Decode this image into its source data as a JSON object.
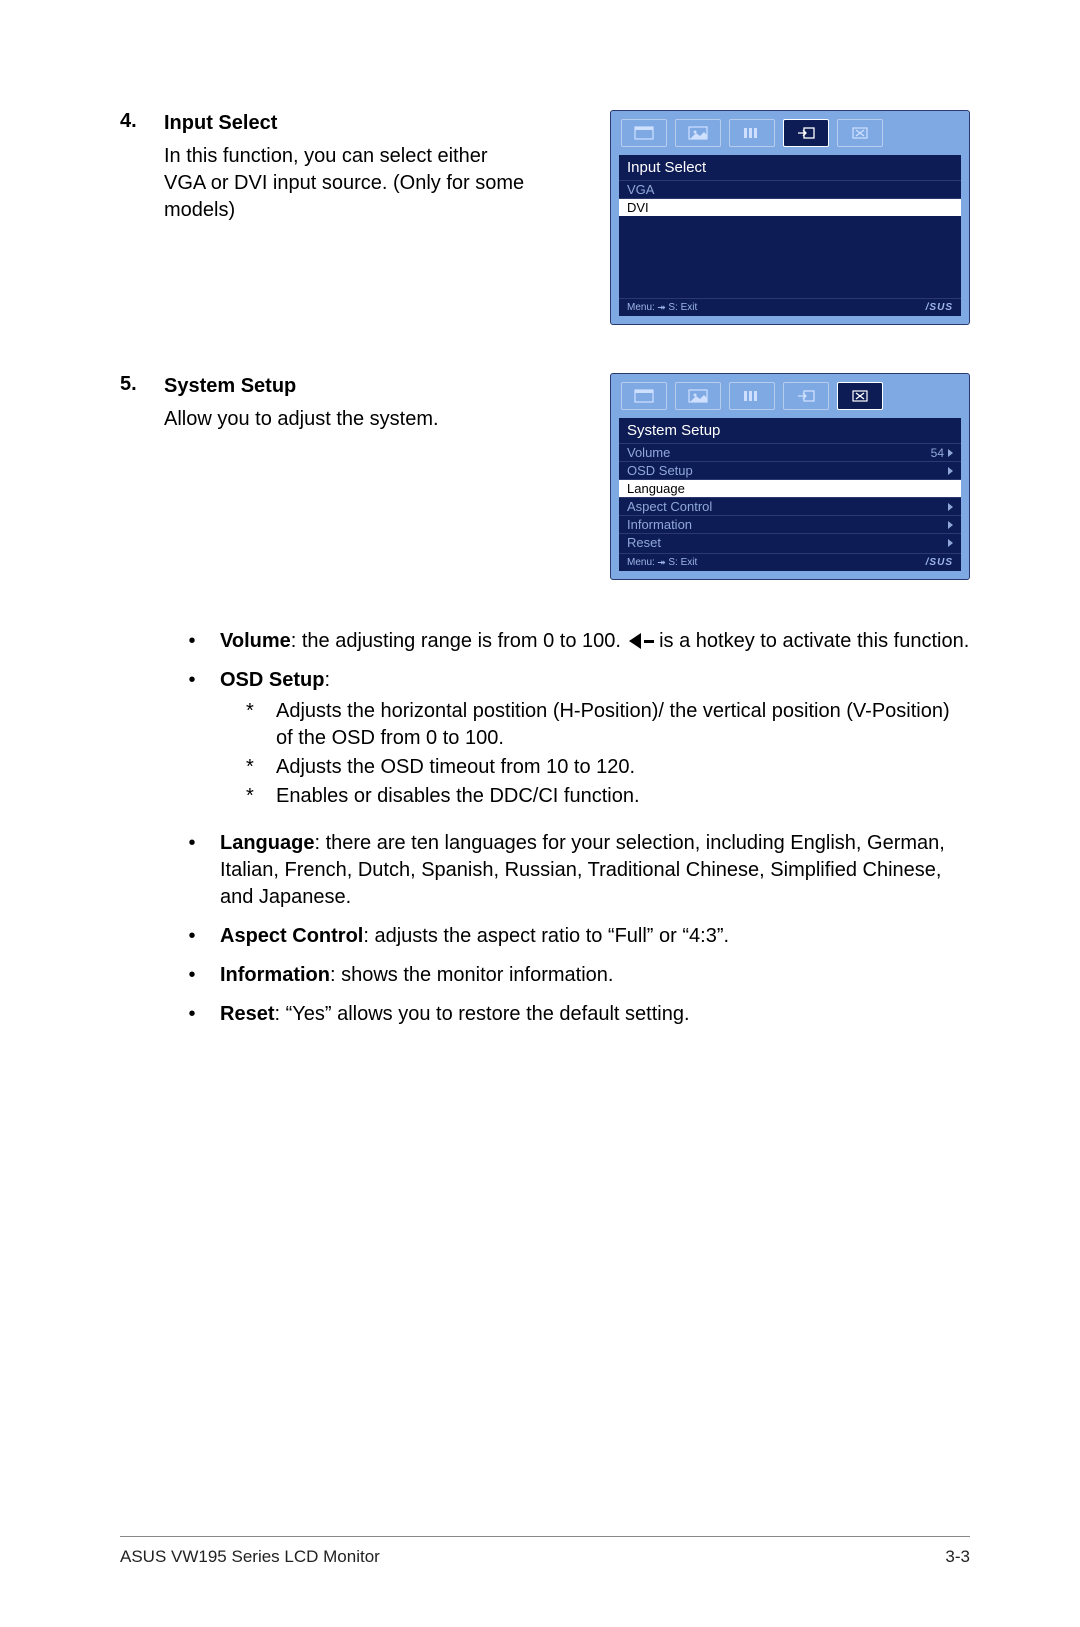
{
  "sections": [
    {
      "num": "4.",
      "title": "Input Select",
      "body": "In this function, you can select either VGA or DVI input source. (Only for some models)"
    },
    {
      "num": "5.",
      "title": "System Setup",
      "body": "Allow you to adjust the system."
    }
  ],
  "osd1": {
    "title": "Input Select",
    "rows": [
      {
        "label": "VGA",
        "value": "",
        "hl": false
      },
      {
        "label": "DVI",
        "value": "",
        "hl": true
      }
    ],
    "footer_left": "Menu: ⯮   S: Exit",
    "brand": "/SUS",
    "selected_tab": 3
  },
  "osd2": {
    "title": "System Setup",
    "rows": [
      {
        "label": "Volume",
        "value": "54",
        "arrow": true,
        "hl": false
      },
      {
        "label": "OSD Setup",
        "value": "",
        "arrow": true,
        "hl": false
      },
      {
        "label": "Language",
        "value": "",
        "arrow": false,
        "hl": true
      },
      {
        "label": "Aspect Control",
        "value": "",
        "arrow": true,
        "hl": false
      },
      {
        "label": "Information",
        "value": "",
        "arrow": true,
        "hl": false
      },
      {
        "label": "Reset",
        "value": "",
        "arrow": true,
        "hl": false
      }
    ],
    "footer_left": "Menu: ⯮   S: Exit",
    "brand": "/SUS",
    "selected_tab": 4
  },
  "bullets": {
    "volume_label": "Volume",
    "volume_pre": ": the adjusting range is from 0 to 100. ",
    "volume_post": " is a hotkey to activate this function.",
    "osd_label": "OSD Setup",
    "osd_colon": ":",
    "osd_sub": [
      "Adjusts the horizontal postition (H-Position)/ the vertical position  (V-Position) of the OSD from 0 to 100.",
      "Adjusts the OSD timeout from 10 to 120.",
      "Enables or disables the DDC/CI function."
    ],
    "lang_label": "Language",
    "lang_text": ": there are ten languages for your selection, including English, German, Italian, French, Dutch, Spanish, Russian, Traditional Chinese, Simplified Chinese, and Japanese.",
    "aspect_label": "Aspect Control",
    "aspect_text": ": adjusts the aspect ratio to “Full” or “4:3”.",
    "info_label": "Information",
    "info_text": ": shows the monitor information.",
    "reset_label": "Reset",
    "reset_text": ": “Yes” allows you to restore the default setting."
  },
  "footer": {
    "left": "ASUS VW195 Series LCD Monitor",
    "right": "3-3"
  }
}
